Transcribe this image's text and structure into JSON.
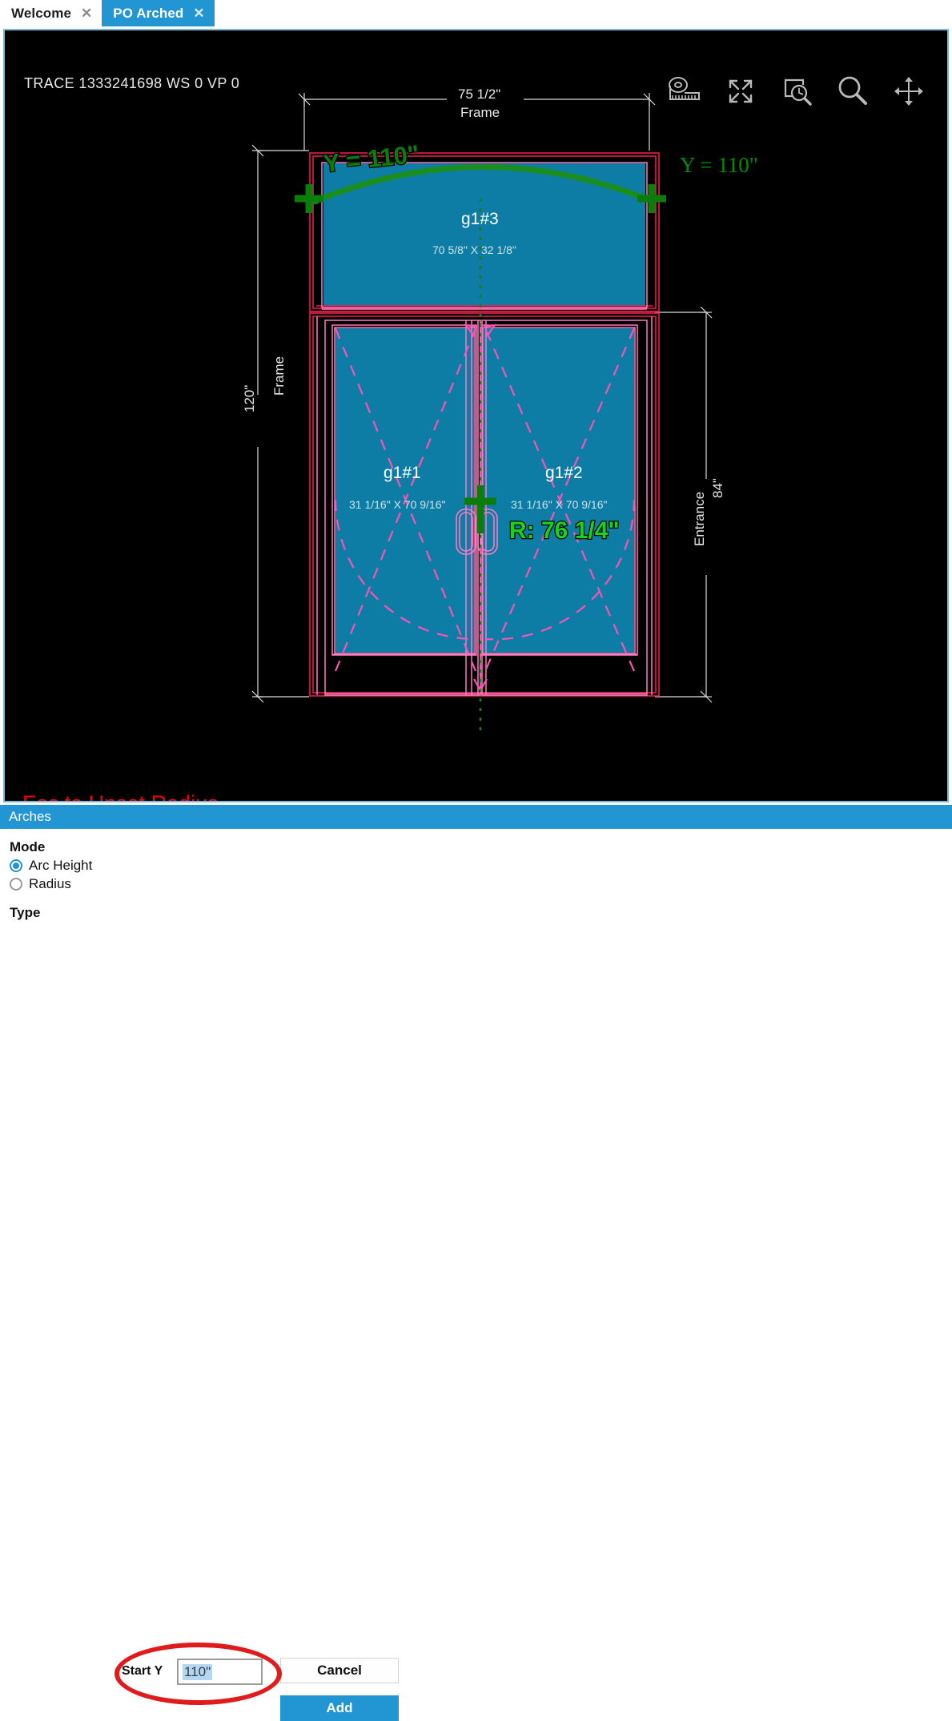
{
  "tabs": [
    {
      "label": "Welcome",
      "close": "✕",
      "active": false
    },
    {
      "label": "PO Arched",
      "close": "✕",
      "active": true
    }
  ],
  "viewport": {
    "trace_label": "TRACE 1333241698  WS 0  VP 0",
    "status_hint": "Esc to Unset Radius",
    "background": "#000000",
    "border_color": "#76b9dc"
  },
  "cad_toolbar": [
    {
      "name": "tape-measure-icon",
      "title": "Measure"
    },
    {
      "name": "fit-to-screen-icon",
      "title": "Fit"
    },
    {
      "name": "zoom-window-icon",
      "title": "Zoom Window"
    },
    {
      "name": "magnifier-icon",
      "title": "Zoom"
    },
    {
      "name": "pan-move-icon",
      "title": "Pan"
    }
  ],
  "dimensions": {
    "top": {
      "value": "75 1/2\"",
      "name": "Frame"
    },
    "left": {
      "value": "120\"",
      "name": "Frame"
    },
    "right": {
      "value": "84\"",
      "name": "Entrance"
    }
  },
  "glass": [
    {
      "name": "g1#3",
      "size": "70 5/8\" X 32 1/8\""
    },
    {
      "name": "g1#1",
      "size": "31 1/16\" X 70 9/16\""
    },
    {
      "name": "g1#2",
      "size": "31 1/16\" X 70 9/16\""
    }
  ],
  "annotations": {
    "arc_label": "Y = 110\"",
    "arc_label_right": "Y = 110\"",
    "radius_label": "R: 76 1/4\""
  },
  "colors": {
    "glass_fill": "#0e7da6",
    "frame_red": "#e81d4e",
    "frame_pink": "#ff7ac0",
    "swing_pink": "#f754b4",
    "marker_green": "#0a7d0a",
    "accent_blue": "#2196d3",
    "alert_red": "#f40000"
  },
  "panel": {
    "title": "Arches",
    "mode": {
      "title": "Mode",
      "options": [
        {
          "label": "Arc Height",
          "selected": true
        },
        {
          "label": "Radius",
          "selected": false
        }
      ]
    },
    "type_title": "Type",
    "start_y": {
      "label": "Start Y",
      "value": "110\"",
      "placeholder": "110\""
    },
    "cancel_label": "Cancel",
    "add_label": "Add"
  }
}
